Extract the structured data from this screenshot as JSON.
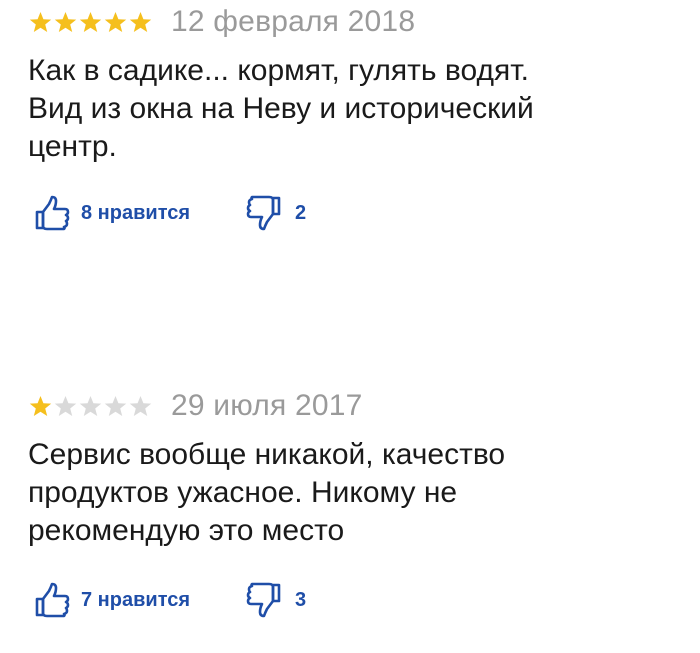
{
  "reviews": [
    {
      "rating": 5,
      "max_rating": 5,
      "date": "12 февраля 2018",
      "lines": [
        "Как в садике... кормят, гулять водят.",
        "Вид из окна на Неву и исторический",
        "центр."
      ],
      "likes_label": "8 нравится",
      "dislikes_label": "2"
    },
    {
      "rating": 1,
      "max_rating": 5,
      "date": "29 июля 2017",
      "lines": [
        "Сервис вообще никакой, качество",
        "продуктов ужасное. Никому не",
        "рекомендую это место"
      ],
      "likes_label": "7 нравится",
      "dislikes_label": "3"
    }
  ],
  "colors": {
    "star_filled": "#f5bf1d",
    "star_empty": "#d9d9d9",
    "vote_blue": "#1f4ea8",
    "date_gray": "#9a9a9a"
  },
  "icons": {
    "star": "star-icon",
    "like": "thumbs-up-icon",
    "dislike": "thumbs-down-icon"
  }
}
